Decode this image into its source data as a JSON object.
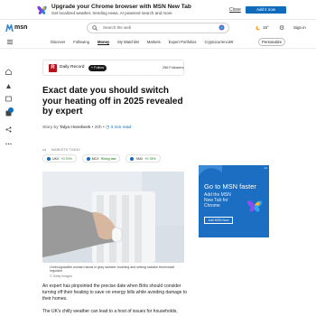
{
  "promo": {
    "title": "Upgrade your Chrome browser with MSN New Tab",
    "subtitle": "Get localized weather, trending news, AI powered search and more",
    "close_label": "Close",
    "add_label": "Add it now"
  },
  "header": {
    "logo_text": "msn",
    "search_placeholder": "Search the web",
    "weather_temp": "15°",
    "sign_in_label": "Sign in"
  },
  "nav": {
    "items": [
      "Discover",
      "Following",
      "Money",
      "My Watchlist",
      "Markets",
      "Expert Portfolios",
      "Cryptocurrencies"
    ],
    "more_label": "···",
    "personalize_label": "Personalize"
  },
  "publisher": {
    "logo_letter": "R",
    "name": "Daily Record",
    "follow_label": "+ Follow",
    "followers": "256 Followers"
  },
  "article": {
    "headline": "Exact date you should switch your heating off in 2025 revealed by expert",
    "byline_prefix": "Story by",
    "author": "Talya Honebeek",
    "age": "• 20h •",
    "read_time": "3 min read",
    "caption": "Unrecognizable woman hands in gray sweater touching and setting radiator thermostat regulator",
    "caption_credit": "© Getty Images",
    "para1": "An expert has pinpointed the precise date when Brits should consider turning off their heating to save on energy bills while avoiding damage to their homes.",
    "para2": "The UK's chilly weather can lead to a host of issues for households,"
  },
  "markets": {
    "dots": "•••",
    "label": "MARKETS TODAY",
    "tickers": [
      {
        "name": "UKX",
        "change": "+0.70%"
      },
      {
        "name": "MCX",
        "change": "Rising fast"
      },
      {
        "name": "SMX",
        "change": "+0.78%"
      }
    ]
  },
  "ad": {
    "badge": "Ad",
    "title": "Go to MSN faster",
    "subtitle": "Add the MSN New Tab for Chrome",
    "button_label": "Add MSN Now"
  },
  "colors": {
    "accent": "#0f6cbd",
    "publisher_red": "#b3131b",
    "ad_blue": "#1b6ec2",
    "positive": "#107c10"
  }
}
